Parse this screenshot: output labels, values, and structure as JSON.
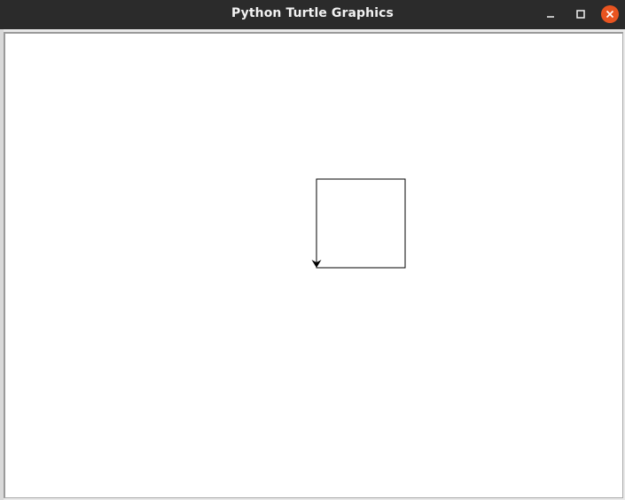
{
  "window": {
    "title": "Python Turtle Graphics"
  },
  "controls": {
    "minimize_icon": "minimize-icon",
    "maximize_icon": "maximize-icon",
    "close_icon": "close-icon",
    "close_color": "#e95420"
  },
  "canvas": {
    "background": "#ffffff",
    "drawing": "square",
    "turtle_heading": "down",
    "pen_color": "#000000"
  }
}
